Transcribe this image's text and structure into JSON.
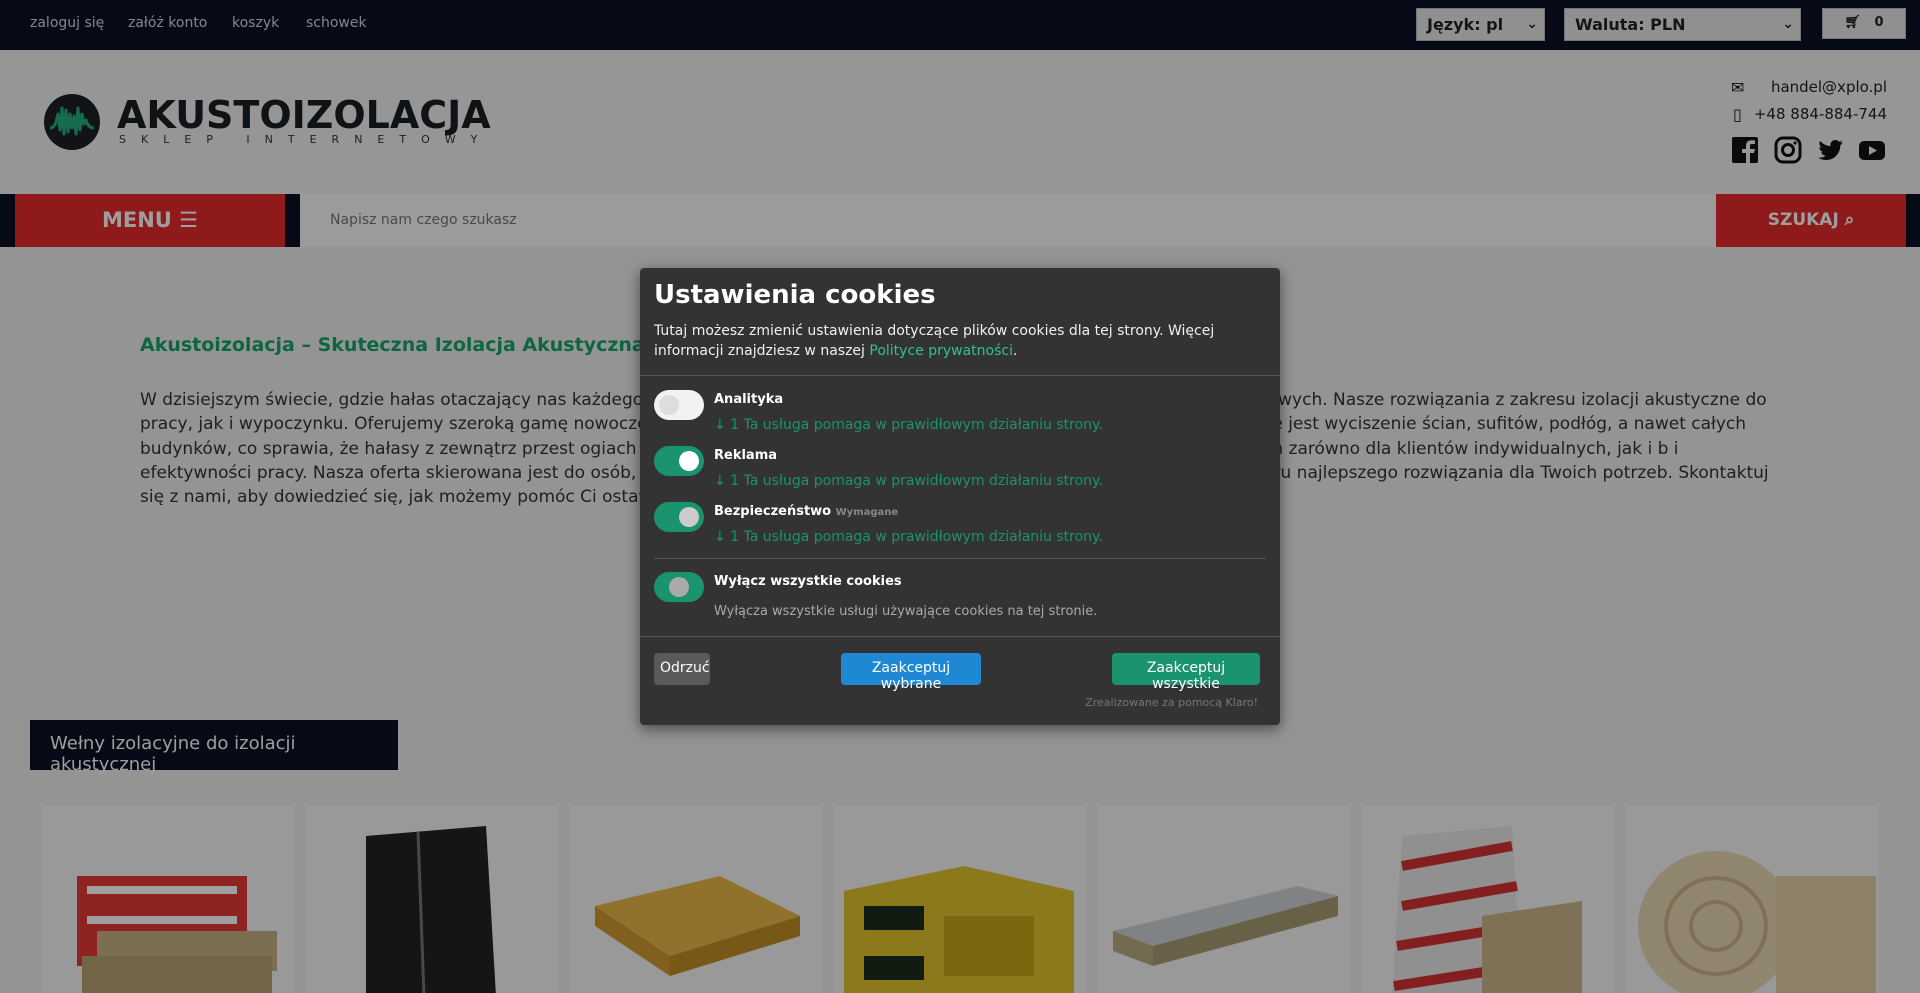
{
  "topbar": {
    "links": [
      "zaloguj się",
      "załóż konto",
      "koszyk",
      "schowek"
    ],
    "language_select": "Język: pl",
    "currency_select": "Waluta: PLN",
    "cart_count": "0"
  },
  "header": {
    "logo_title": "AKUSTOIZOLACJA",
    "logo_subtitle": "SKLEP INTERNETOWY",
    "email": "handel@xplo.pl",
    "phone": "+48 884-884-744",
    "social": [
      "facebook-icon",
      "instagram-icon",
      "twitter-icon",
      "youtube-icon"
    ]
  },
  "nav": {
    "menu_label": "MENU ☰",
    "search_placeholder": "Napisz nam czego szukasz",
    "search_button": "SZUKAJ"
  },
  "content": {
    "headline": "Akustoizolacja – Skuteczna Izolacja Akustyczna Dla T",
    "paragraph": "W dzisiejszym świecie, gdzie hałas otaczający nas każdego dnia s                                                                                          szy i komfortu w Twoim domu, biurze czy przestrzeniach przemysłowych. Nasze rozwiązania z zakresu izolacji akustyczne                                                                                  do pracy, jak i wypoczynku. Oferujemy szeroką gamę nowoczesnych materiałów akustycznych, które gwarantują najw                                                                        roduktom możliwe jest wyciszenie ścian, sufitów, podłóg, a nawet całych budynków, co sprawia, że hałasy z zewnątrz przest                                                                       ogiach i spełniają rygorystyczne normy akustyczne, co czyni je idealnym wyborem zarówno dla klientów indywidualnych, jak i b                                                                          i efektywności pracy. Nasza oferta skierowana jest do osób, które cenią sobie spokój i komfort, jednocześnie dbając o estetyk                                                                       n i wyboru najlepszego rozwiązania dla Twoich potrzeb. Skontaktuj się z nami, aby dowiedzieć się, jak możemy pomóc Ci                                                                              ostaw na sprawdzone rozwiązania w zakresie akustoizolacji!",
    "section_title": "Wełny izolacyjne do izolacji akustycznej",
    "products": [
      "rockwool-pack",
      "black-panel",
      "yellow-boards",
      "isover-pack",
      "foil-boards",
      "paroc-pack",
      "wool-roll"
    ]
  },
  "cookie_modal": {
    "title": "Ustawienia cookies",
    "description": "Tutaj możesz zmienić ustawienia dotyczące plików cookies dla tej strony. Więcej informacji znajdziesz w naszej ",
    "policy_link": "Polityce prywatności",
    "description_end": ".",
    "services": [
      {
        "name": "Analityka",
        "note": "↓ 1 Ta usługa pomaga w prawidłowym działaniu strony.",
        "enabled": false
      },
      {
        "name": "Reklama",
        "note": "↓ 1 Ta usługa pomaga w prawidłowym działaniu strony.",
        "enabled": true
      },
      {
        "name": "Bezpieczeństwo",
        "required": "Wymagane",
        "note": "↓ 1 Ta usługa pomaga w prawidłowym działaniu strony.",
        "enabled": true
      }
    ],
    "disable_all": {
      "name": "Wyłącz wszystkie cookies",
      "desc": "Wyłącza wszystkie usługi używające cookies na tej stronie."
    },
    "buttons": {
      "decline": "Odrzuć",
      "accept_selected": "Zaakceptuj wybrane",
      "accept_all": "Zaakceptuj wszystkie"
    },
    "credit": "Zrealizowane za pomocą Klaro!",
    "colors": {
      "accent": "#1a936f",
      "blue": "#1e88d4",
      "modal_bg": "#333333"
    }
  }
}
